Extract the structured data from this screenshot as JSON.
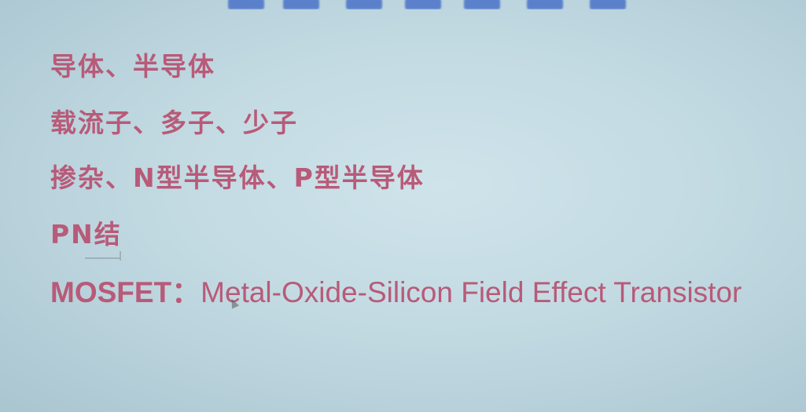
{
  "slide": {
    "lines": [
      "导体、半导体",
      "载流子、多子、少子",
      "掺杂、N型半导体、P型半导体",
      "PN结"
    ],
    "mosfet": {
      "term": "MOSFET",
      "colon": "：",
      "definition": "Metal-Oxide-Silicon Field Effect Transistor"
    }
  },
  "colors": {
    "text": "#b85a78",
    "background": "#c4dbe3",
    "title_fragment": "#4a72c9"
  },
  "icons": {
    "pointer": "mouse-pointer-icon"
  }
}
